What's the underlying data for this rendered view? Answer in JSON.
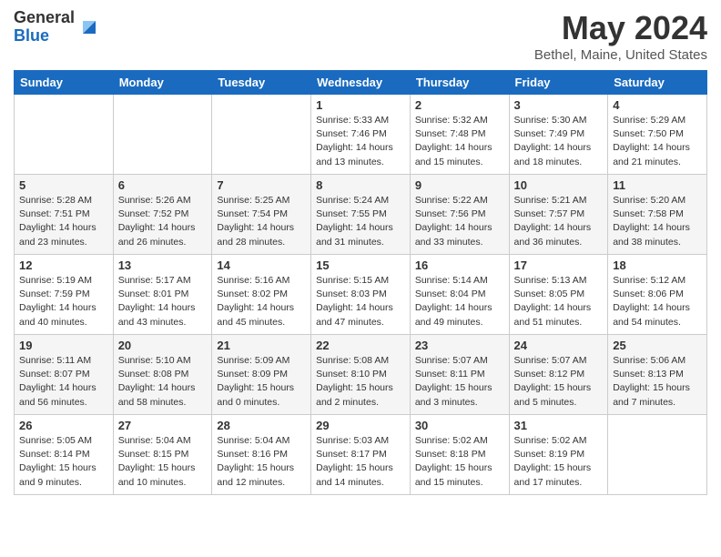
{
  "header": {
    "logo_general": "General",
    "logo_blue": "Blue",
    "title": "May 2024",
    "location": "Bethel, Maine, United States"
  },
  "weekdays": [
    "Sunday",
    "Monday",
    "Tuesday",
    "Wednesday",
    "Thursday",
    "Friday",
    "Saturday"
  ],
  "weeks": [
    [
      {
        "day": "",
        "info": ""
      },
      {
        "day": "",
        "info": ""
      },
      {
        "day": "",
        "info": ""
      },
      {
        "day": "1",
        "info": "Sunrise: 5:33 AM\nSunset: 7:46 PM\nDaylight: 14 hours\nand 13 minutes."
      },
      {
        "day": "2",
        "info": "Sunrise: 5:32 AM\nSunset: 7:48 PM\nDaylight: 14 hours\nand 15 minutes."
      },
      {
        "day": "3",
        "info": "Sunrise: 5:30 AM\nSunset: 7:49 PM\nDaylight: 14 hours\nand 18 minutes."
      },
      {
        "day": "4",
        "info": "Sunrise: 5:29 AM\nSunset: 7:50 PM\nDaylight: 14 hours\nand 21 minutes."
      }
    ],
    [
      {
        "day": "5",
        "info": "Sunrise: 5:28 AM\nSunset: 7:51 PM\nDaylight: 14 hours\nand 23 minutes."
      },
      {
        "day": "6",
        "info": "Sunrise: 5:26 AM\nSunset: 7:52 PM\nDaylight: 14 hours\nand 26 minutes."
      },
      {
        "day": "7",
        "info": "Sunrise: 5:25 AM\nSunset: 7:54 PM\nDaylight: 14 hours\nand 28 minutes."
      },
      {
        "day": "8",
        "info": "Sunrise: 5:24 AM\nSunset: 7:55 PM\nDaylight: 14 hours\nand 31 minutes."
      },
      {
        "day": "9",
        "info": "Sunrise: 5:22 AM\nSunset: 7:56 PM\nDaylight: 14 hours\nand 33 minutes."
      },
      {
        "day": "10",
        "info": "Sunrise: 5:21 AM\nSunset: 7:57 PM\nDaylight: 14 hours\nand 36 minutes."
      },
      {
        "day": "11",
        "info": "Sunrise: 5:20 AM\nSunset: 7:58 PM\nDaylight: 14 hours\nand 38 minutes."
      }
    ],
    [
      {
        "day": "12",
        "info": "Sunrise: 5:19 AM\nSunset: 7:59 PM\nDaylight: 14 hours\nand 40 minutes."
      },
      {
        "day": "13",
        "info": "Sunrise: 5:17 AM\nSunset: 8:01 PM\nDaylight: 14 hours\nand 43 minutes."
      },
      {
        "day": "14",
        "info": "Sunrise: 5:16 AM\nSunset: 8:02 PM\nDaylight: 14 hours\nand 45 minutes."
      },
      {
        "day": "15",
        "info": "Sunrise: 5:15 AM\nSunset: 8:03 PM\nDaylight: 14 hours\nand 47 minutes."
      },
      {
        "day": "16",
        "info": "Sunrise: 5:14 AM\nSunset: 8:04 PM\nDaylight: 14 hours\nand 49 minutes."
      },
      {
        "day": "17",
        "info": "Sunrise: 5:13 AM\nSunset: 8:05 PM\nDaylight: 14 hours\nand 51 minutes."
      },
      {
        "day": "18",
        "info": "Sunrise: 5:12 AM\nSunset: 8:06 PM\nDaylight: 14 hours\nand 54 minutes."
      }
    ],
    [
      {
        "day": "19",
        "info": "Sunrise: 5:11 AM\nSunset: 8:07 PM\nDaylight: 14 hours\nand 56 minutes."
      },
      {
        "day": "20",
        "info": "Sunrise: 5:10 AM\nSunset: 8:08 PM\nDaylight: 14 hours\nand 58 minutes."
      },
      {
        "day": "21",
        "info": "Sunrise: 5:09 AM\nSunset: 8:09 PM\nDaylight: 15 hours\nand 0 minutes."
      },
      {
        "day": "22",
        "info": "Sunrise: 5:08 AM\nSunset: 8:10 PM\nDaylight: 15 hours\nand 2 minutes."
      },
      {
        "day": "23",
        "info": "Sunrise: 5:07 AM\nSunset: 8:11 PM\nDaylight: 15 hours\nand 3 minutes."
      },
      {
        "day": "24",
        "info": "Sunrise: 5:07 AM\nSunset: 8:12 PM\nDaylight: 15 hours\nand 5 minutes."
      },
      {
        "day": "25",
        "info": "Sunrise: 5:06 AM\nSunset: 8:13 PM\nDaylight: 15 hours\nand 7 minutes."
      }
    ],
    [
      {
        "day": "26",
        "info": "Sunrise: 5:05 AM\nSunset: 8:14 PM\nDaylight: 15 hours\nand 9 minutes."
      },
      {
        "day": "27",
        "info": "Sunrise: 5:04 AM\nSunset: 8:15 PM\nDaylight: 15 hours\nand 10 minutes."
      },
      {
        "day": "28",
        "info": "Sunrise: 5:04 AM\nSunset: 8:16 PM\nDaylight: 15 hours\nand 12 minutes."
      },
      {
        "day": "29",
        "info": "Sunrise: 5:03 AM\nSunset: 8:17 PM\nDaylight: 15 hours\nand 14 minutes."
      },
      {
        "day": "30",
        "info": "Sunrise: 5:02 AM\nSunset: 8:18 PM\nDaylight: 15 hours\nand 15 minutes."
      },
      {
        "day": "31",
        "info": "Sunrise: 5:02 AM\nSunset: 8:19 PM\nDaylight: 15 hours\nand 17 minutes."
      },
      {
        "day": "",
        "info": ""
      }
    ]
  ]
}
